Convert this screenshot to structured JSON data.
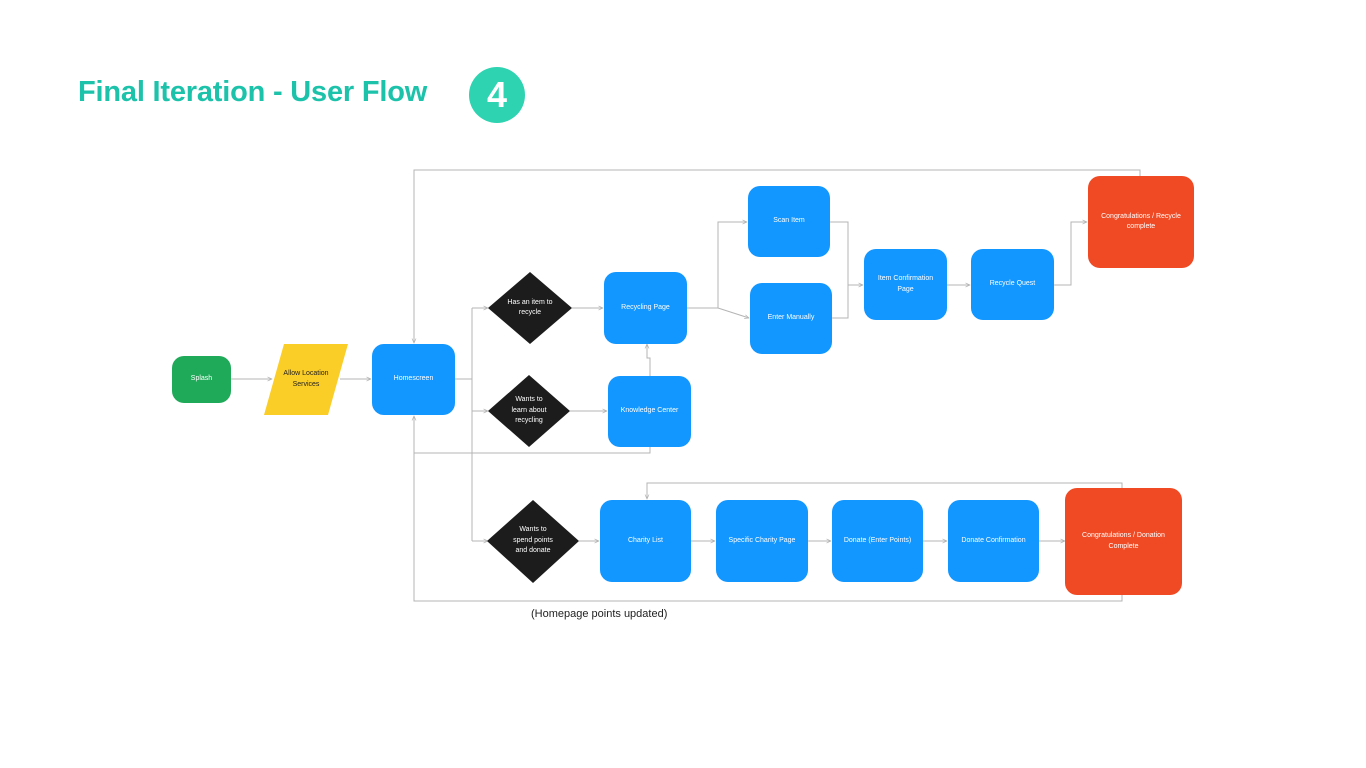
{
  "header": {
    "title": "Final Iteration - User Flow",
    "badge": "4"
  },
  "colors": {
    "title": "#1cc2aa",
    "badge": "#2ed3b1",
    "screen": "#1296ff",
    "start": "#1faa59",
    "input": "#fbcd27",
    "decision": "#1c1c1c",
    "end": "#f04a24",
    "connector": "#b4b4b4"
  },
  "nodes": {
    "splash": "Splash",
    "allow_location": "Allow Location Services",
    "homescreen": "Homescreen",
    "decision_recycle": "Has an item to recycle",
    "decision_learn": "Wants to learn about recycling",
    "decision_donate": "Wants to spend points and donate",
    "recycling_page": "Recycling Page",
    "knowledge_center": "Knowledge Center",
    "scan_item": "Scan Item",
    "enter_manually": "Enter Manually",
    "item_confirmation": "Item Confirmation Page",
    "recycle_quest": "Recycle Quest",
    "congrats_recycle": "Congratulations / Recycle complete",
    "charity_list": "Charity List",
    "specific_charity": "Specific Charity Page",
    "donate_points": "Donate (Enter Points)",
    "donate_confirmation": "Donate Confirmation",
    "congrats_donation": "Congratulations / Donation Complete"
  },
  "footnote": "(Homepage points updated)"
}
